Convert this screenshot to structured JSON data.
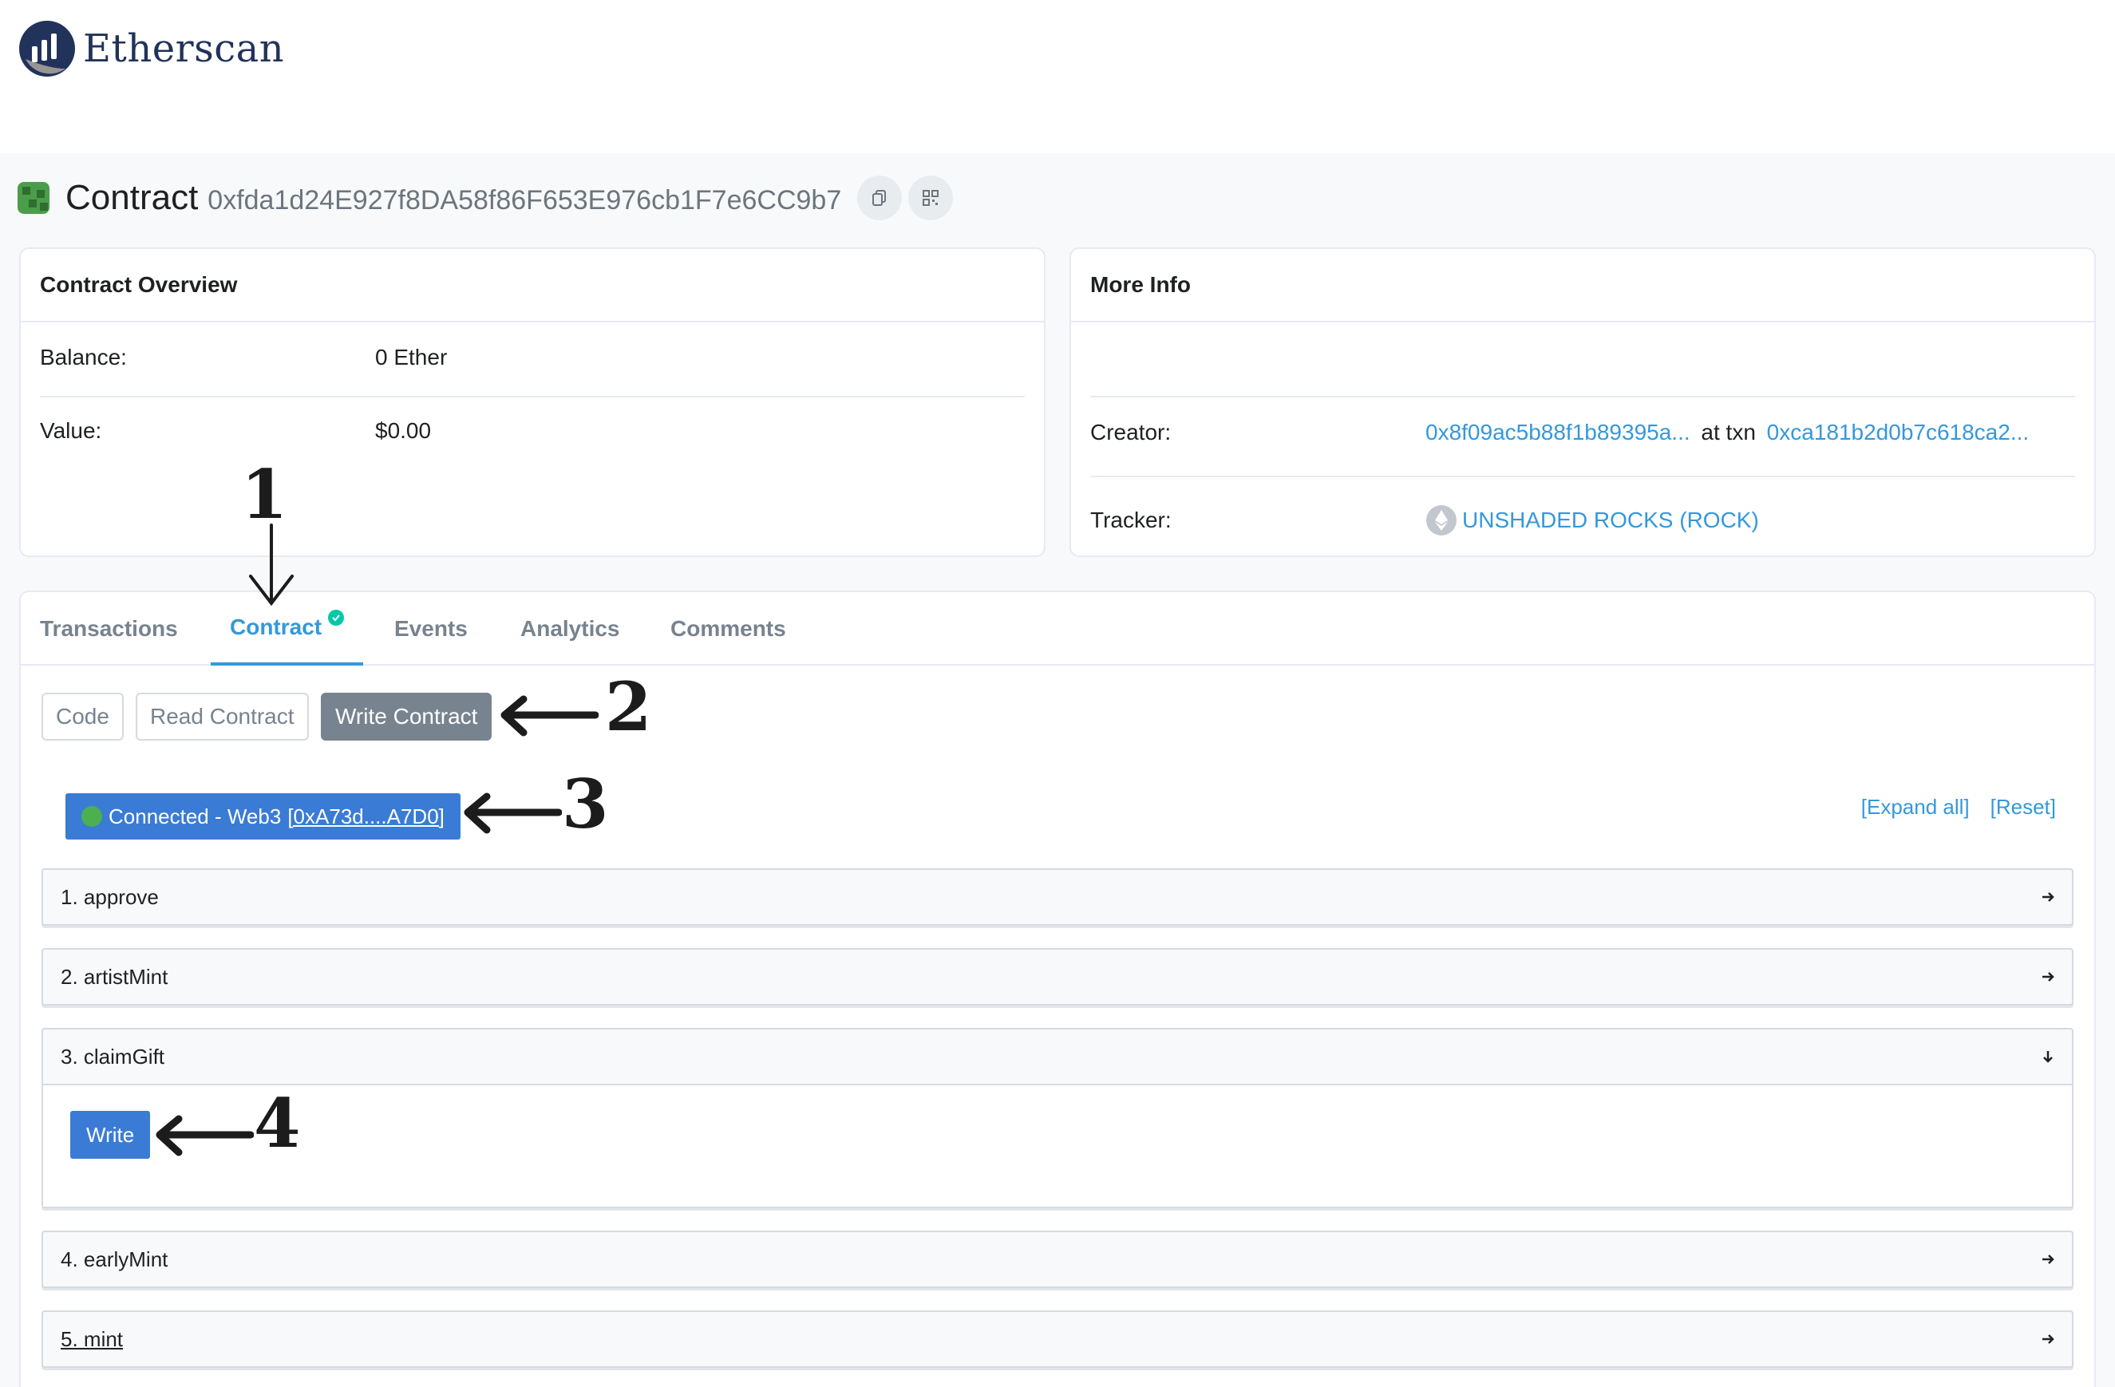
{
  "brand": {
    "name": "Etherscan",
    "logo_icon": "etherscan-logo-icon"
  },
  "page": {
    "title": "Contract",
    "address": "0xfda1d24E927f8DA58f86F653E976cb1F7e6CC9b7",
    "copy_icon": "copy-icon",
    "qr_icon": "qr-code-icon"
  },
  "overview": {
    "header": "Contract Overview",
    "balance_label": "Balance:",
    "balance_value": "0 Ether",
    "value_label": "Value:",
    "value_value": "$0.00"
  },
  "more_info": {
    "header": "More Info",
    "creator_label": "Creator:",
    "creator_address": "0x8f09ac5b88f1b89395a...",
    "creator_at_txn": "at txn",
    "creator_txn": "0xca181b2d0b7c618ca2...",
    "tracker_label": "Tracker:",
    "tracker_value": "UNSHADED ROCKS (ROCK)",
    "tracker_icon": "ethereum-token-icon"
  },
  "tabs": [
    {
      "label": "Transactions"
    },
    {
      "label": "Contract",
      "active": true,
      "badge_icon": "verified-check-icon"
    },
    {
      "label": "Events"
    },
    {
      "label": "Analytics"
    },
    {
      "label": "Comments"
    }
  ],
  "subtabs": [
    {
      "label": "Code"
    },
    {
      "label": "Read Contract"
    },
    {
      "label": "Write Contract",
      "active": true
    }
  ],
  "connection": {
    "status": "Connected - Web3",
    "address": "[0xA73d....A7D0]"
  },
  "actions": {
    "expand_all": "[Expand all]",
    "reset": "[Reset]"
  },
  "functions": [
    {
      "label": "1. approve",
      "expanded": false
    },
    {
      "label": "2. artistMint",
      "expanded": false
    },
    {
      "label": "3. claimGift",
      "expanded": true,
      "button": "Write"
    },
    {
      "label": "4. earlyMint",
      "expanded": false
    },
    {
      "label": "5. mint",
      "expanded": false
    }
  ],
  "annotations": [
    "1",
    "2",
    "3",
    "4"
  ],
  "colors": {
    "accent": "#3498db",
    "button_blue": "#3a7bd5",
    "active_tab_button": "#77838f",
    "success": "#00c9a7"
  }
}
